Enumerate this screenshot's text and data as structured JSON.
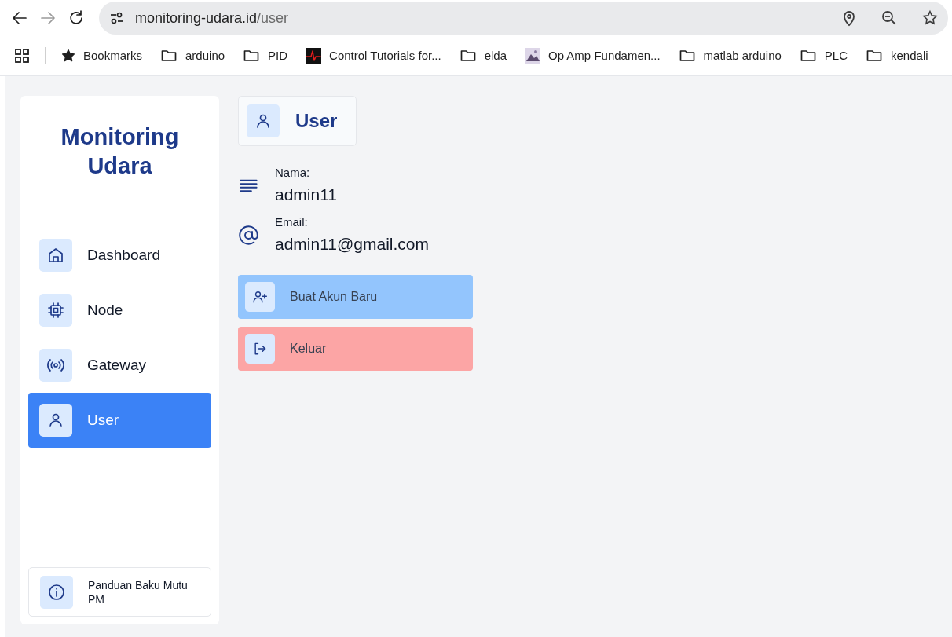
{
  "browser": {
    "url_host": "monitoring-udara.id",
    "url_path": "/user",
    "bookmarks": [
      {
        "kind": "star",
        "label": "Bookmarks"
      },
      {
        "kind": "folder",
        "label": "arduino"
      },
      {
        "kind": "folder",
        "label": "PID"
      },
      {
        "kind": "site",
        "label": "Control Tutorials for..."
      },
      {
        "kind": "folder",
        "label": "elda"
      },
      {
        "kind": "photo",
        "label": "Op Amp Fundamen..."
      },
      {
        "kind": "folder",
        "label": "matlab arduino"
      },
      {
        "kind": "folder",
        "label": "PLC"
      },
      {
        "kind": "folder",
        "label": "kendali"
      }
    ]
  },
  "sidebar": {
    "title": "Monitoring Udara",
    "items": [
      {
        "kind": "home",
        "label": "Dashboard",
        "selected": false
      },
      {
        "kind": "chip",
        "label": "Node",
        "selected": false
      },
      {
        "kind": "broadcast",
        "label": "Gateway",
        "selected": false
      },
      {
        "kind": "user",
        "label": "User",
        "selected": true
      }
    ],
    "footer": {
      "label": "Panduan Baku Mutu PM"
    }
  },
  "header": {
    "title": "User"
  },
  "fields": [
    {
      "kind": "name",
      "label": "Nama:",
      "value": "admin11"
    },
    {
      "kind": "email",
      "label": "Email:",
      "value": "admin11@gmail.com"
    }
  ],
  "buttons": [
    {
      "kind": "create",
      "label": "Buat Akun Baru"
    },
    {
      "kind": "logout",
      "label": "Keluar"
    }
  ]
}
